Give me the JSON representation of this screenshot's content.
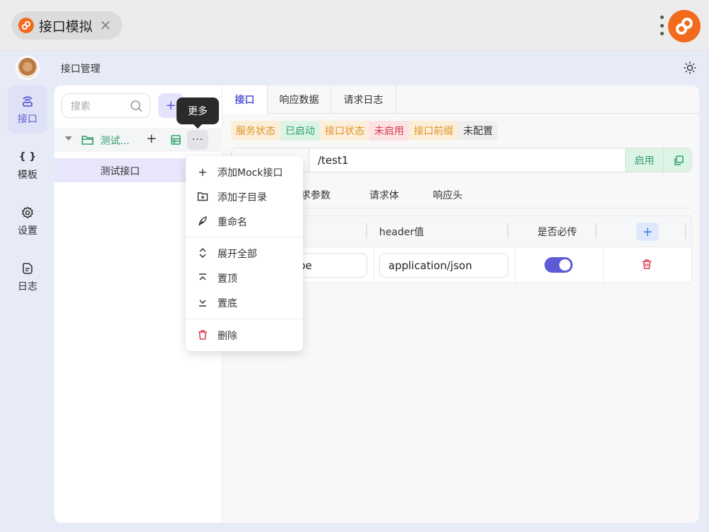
{
  "window": {
    "tab_title": "接口模拟",
    "close_glyph": "✕",
    "brand_color": "#f26b1d"
  },
  "sidebar": {
    "items": [
      {
        "label": "接口",
        "icon": "api-icon",
        "active": true
      },
      {
        "label": "模板",
        "icon": "braces-icon",
        "active": false
      },
      {
        "label": "设置",
        "icon": "gear-icon",
        "active": false
      },
      {
        "label": "日志",
        "icon": "log-icon",
        "active": false
      }
    ],
    "braces_glyph": "{ }"
  },
  "header": {
    "breadcrumb": "接口管理",
    "theme_icon": "sun-icon"
  },
  "tree": {
    "search_placeholder": "搜索",
    "add_glyph": "+",
    "folder_name": "测试...",
    "folder_add_glyph": "+",
    "more_glyph": "···",
    "leaf_name": "测试接口",
    "tooltip": "更多"
  },
  "context_menu": {
    "items": [
      {
        "icon": "plus-icon",
        "glyph": "+",
        "label": "添加Mock接口"
      },
      {
        "icon": "folder-add-icon",
        "label": "添加子目录"
      },
      {
        "icon": "feather-icon",
        "label": "重命名"
      },
      {
        "icon": "expand-icon",
        "label": "展开全部"
      },
      {
        "icon": "pin-top-icon",
        "label": "置顶"
      },
      {
        "icon": "pin-bottom-icon",
        "label": "置底"
      },
      {
        "icon": "trash-icon",
        "label": "删除"
      }
    ]
  },
  "tabs": [
    {
      "label": "接口",
      "active": true
    },
    {
      "label": "响应数据",
      "active": false
    },
    {
      "label": "请求日志",
      "active": false
    }
  ],
  "status": {
    "server_label": "服务状态",
    "server_value": "已启动",
    "api_label": "接口状态",
    "api_value": "未启用",
    "prefix_label": "接口前缀",
    "prefix_value": "未配置"
  },
  "url": {
    "path": "/test1",
    "enable_label": "启用",
    "copy_icon": "copy-icon"
  },
  "subtabs": [
    "请求参数",
    "请求体",
    "响应头"
  ],
  "headers_table": {
    "columns": [
      "header值",
      "是否必传"
    ],
    "add_glyph": "+",
    "rows": [
      {
        "name_visible": "pe",
        "value": "application/json",
        "required": true
      }
    ]
  },
  "colors": {
    "accent": "#5b5bd6",
    "success": "#2f9e6a",
    "warning": "#e0932a",
    "danger": "#d83b4b"
  }
}
